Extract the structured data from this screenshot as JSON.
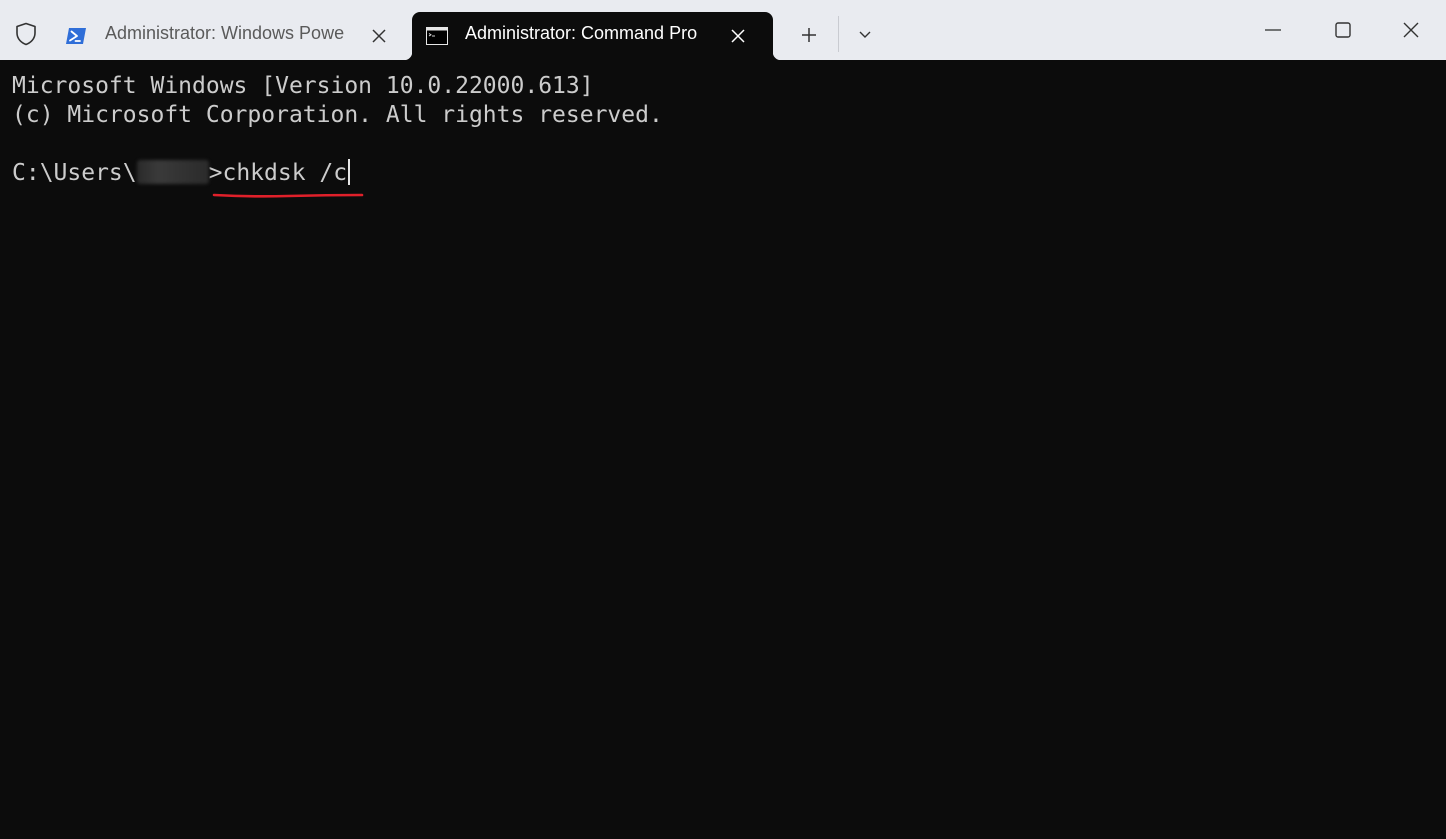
{
  "tabs": [
    {
      "title": "Administrator: Windows Powe",
      "icon": "powershell-icon",
      "active": false
    },
    {
      "title": "Administrator: Command Pro",
      "icon": "command-prompt-icon",
      "active": true
    }
  ],
  "titlebar": {
    "shield_icon": "shield-icon",
    "new_tab_icon": "plus-icon",
    "dropdown_icon": "chevron-down-icon"
  },
  "window_controls": {
    "minimize_icon": "minimize-icon",
    "maximize_icon": "maximize-icon",
    "close_icon": "close-icon"
  },
  "terminal": {
    "lines": [
      "Microsoft Windows [Version 10.0.22000.613]",
      "(c) Microsoft Corporation. All rights reserved."
    ],
    "prompt_prefix": "C:\\Users\\",
    "prompt_suffix": ">",
    "command": "chkdsk /c",
    "colors": {
      "background": "#0c0c0c",
      "text": "#cccccc",
      "annotation": "#e0202a"
    }
  }
}
